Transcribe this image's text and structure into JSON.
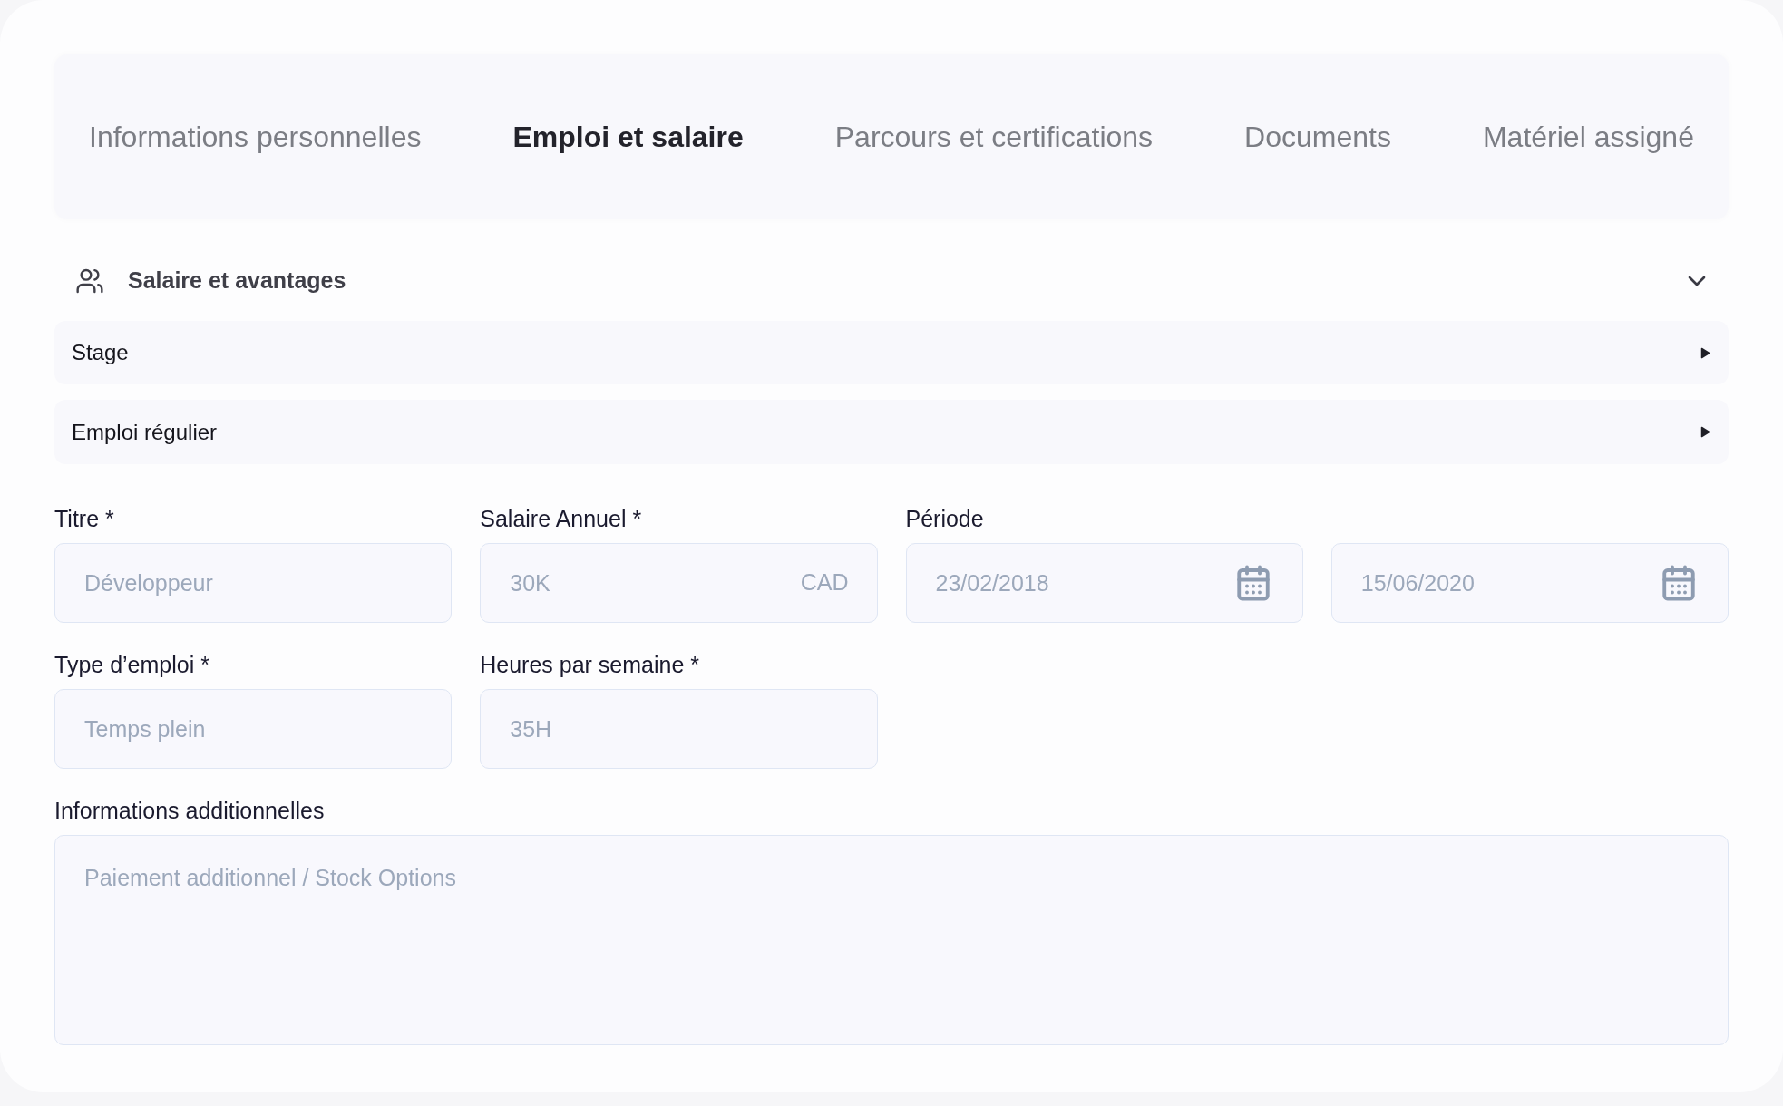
{
  "tabs": [
    {
      "label": "Informations personnelles",
      "selected": false
    },
    {
      "label": "Emploi et salaire",
      "selected": true
    },
    {
      "label": "Parcours et certifications",
      "selected": false
    },
    {
      "label": "Documents",
      "selected": false
    },
    {
      "label": "Matériel assigné",
      "selected": false
    }
  ],
  "section": {
    "title": "Salaire et avantages",
    "expanded": true,
    "items": [
      {
        "label": "Stage",
        "expanded": false
      },
      {
        "label": "Emploi régulier",
        "expanded": false
      }
    ]
  },
  "form": {
    "fields": [
      {
        "kind": "text",
        "label": "Titre *",
        "placeholder": "Développeur"
      },
      {
        "kind": "suffix",
        "label": "Salaire Annuel *",
        "placeholder": "30K",
        "suffix": "CAD"
      },
      {
        "kind": "date_range",
        "label": "Période",
        "inputs": [
          {
            "placeholder": "23/02/2018"
          },
          {
            "placeholder": "15/06/2020"
          }
        ]
      },
      {
        "kind": "text",
        "label": "Type d’emploi *",
        "placeholder": "Temps plein"
      },
      {
        "kind": "text",
        "label": "Heures par semaine *",
        "placeholder": "35H"
      },
      {
        "kind": "textarea",
        "label": "Informations additionnelles",
        "placeholder": "Paiement additionnel / Stock Options"
      }
    ]
  }
}
